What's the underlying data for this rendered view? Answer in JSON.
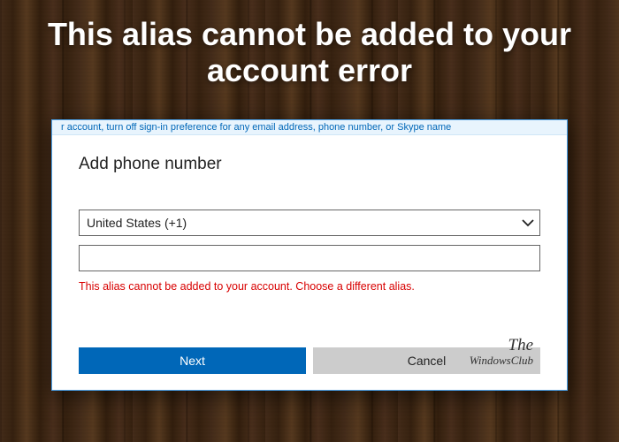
{
  "headline": "This alias cannot be added to your account error",
  "hint_strip": "r account, turn off sign-in preference for any email address, phone number, or Skype name",
  "dialog": {
    "title": "Add phone number",
    "country_selected": "United States (+1)",
    "phone_value": "",
    "error_message": "This alias cannot be added to your account. Choose a different alias.",
    "next_label": "Next",
    "cancel_label": "Cancel"
  },
  "watermark": {
    "line1": "The",
    "line2": "WindowsClub"
  }
}
